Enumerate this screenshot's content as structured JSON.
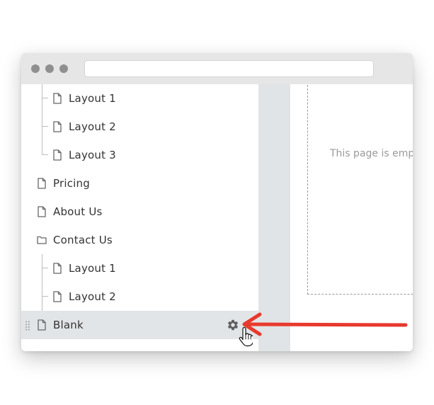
{
  "sidebar": {
    "items": [
      {
        "label": "Layout 1",
        "icon": "page-icon"
      },
      {
        "label": "Layout 2",
        "icon": "page-icon"
      },
      {
        "label": "Layout 3",
        "icon": "page-icon"
      },
      {
        "label": "Pricing",
        "icon": "page-icon"
      },
      {
        "label": "About Us",
        "icon": "page-icon"
      },
      {
        "label": "Contact Us",
        "icon": "folder-icon"
      },
      {
        "label": "Layout 1",
        "icon": "page-icon"
      },
      {
        "label": "Layout 2",
        "icon": "page-icon"
      },
      {
        "label": "Blank",
        "icon": "page-icon",
        "selected": true
      }
    ]
  },
  "canvas": {
    "empty_message": "This page is emp"
  },
  "colors": {
    "titlebar": "#e6e6e6",
    "window_dots": "#8f8f8f",
    "selected_row": "#e2e5e7",
    "gutter": "#e1e4e6",
    "arrow": "#e8392e",
    "dropzone_border": "#9a9a9a"
  }
}
